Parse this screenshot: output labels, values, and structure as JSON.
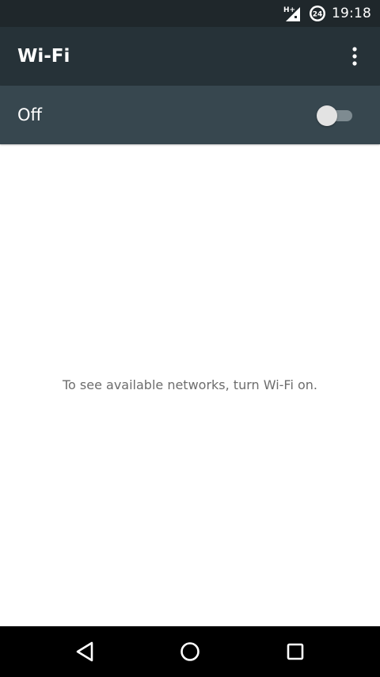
{
  "status_bar": {
    "network_type": "H+",
    "clock_badge": "24",
    "time": "19:18"
  },
  "toolbar": {
    "title": "Wi-Fi",
    "overflow_icon": "more-vert-icon"
  },
  "wifi_switch": {
    "label": "Off",
    "checked": false
  },
  "content": {
    "empty_message": "To see available networks, turn Wi-Fi on."
  },
  "nav_bar": {
    "back_icon": "back-triangle-icon",
    "home_icon": "home-circle-icon",
    "recents_icon": "recents-square-icon"
  },
  "colors": {
    "status_bar": "#1f272b",
    "toolbar": "#263238",
    "switch_bar": "#37474f",
    "message_text": "#6d6d6d",
    "nav_bar": "#000000"
  }
}
